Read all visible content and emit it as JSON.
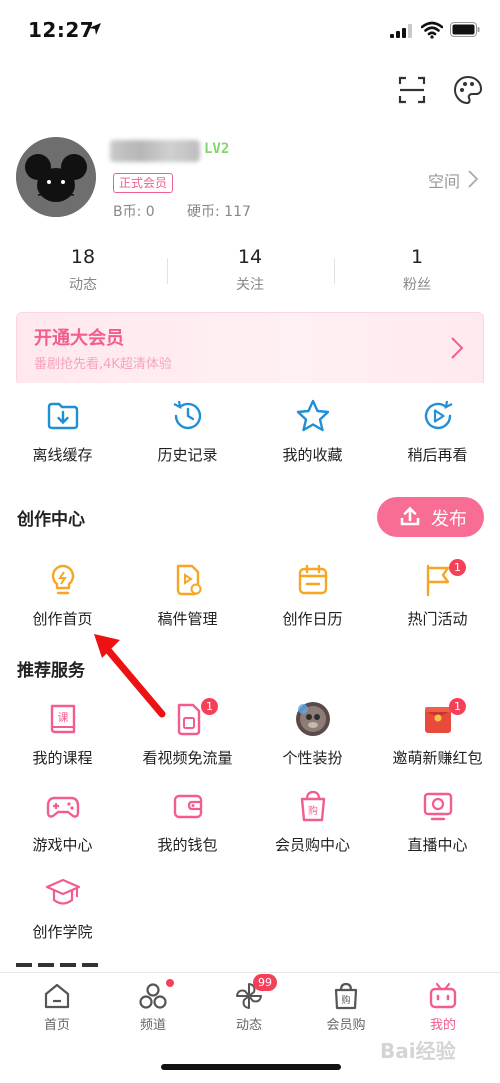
{
  "status_bar": {
    "time": "12:27"
  },
  "profile": {
    "level": "LV2",
    "member_badge": "正式会员",
    "b_coin": "B币: 0",
    "hard_coin": "硬币: 117",
    "space_link": "空间"
  },
  "stats": [
    {
      "value": "18",
      "label": "动态"
    },
    {
      "value": "14",
      "label": "关注"
    },
    {
      "value": "1",
      "label": "粉丝"
    }
  ],
  "vip": {
    "title": "开通大会员",
    "subtitle": "番剧抢先看,4K超清体验"
  },
  "quick_actions": [
    {
      "label": "离线缓存",
      "icon": "download-folder-icon"
    },
    {
      "label": "历史记录",
      "icon": "history-clock-icon"
    },
    {
      "label": "我的收藏",
      "icon": "star-icon"
    },
    {
      "label": "稍后再看",
      "icon": "watch-later-icon"
    }
  ],
  "creation": {
    "title": "创作中心",
    "publish_label": "发布",
    "items": [
      {
        "label": "创作首页",
        "icon": "lightbulb-icon"
      },
      {
        "label": "稿件管理",
        "icon": "manuscript-icon"
      },
      {
        "label": "创作日历",
        "icon": "calendar-icon"
      },
      {
        "label": "热门活动",
        "icon": "flag-icon",
        "badge": "1"
      }
    ]
  },
  "services": {
    "title": "推荐服务",
    "items": [
      {
        "label": "我的课程",
        "icon": "course-book-icon"
      },
      {
        "label": "看视频免流量",
        "icon": "sim-card-icon",
        "badge": "1"
      },
      {
        "label": "个性装扮",
        "icon": "avatar-decoration-icon"
      },
      {
        "label": "邀萌新赚红包",
        "icon": "red-envelope-icon",
        "badge": "1"
      },
      {
        "label": "游戏中心",
        "icon": "gamepad-icon"
      },
      {
        "label": "我的钱包",
        "icon": "wallet-icon"
      },
      {
        "label": "会员购中心",
        "icon": "shopping-bag-icon"
      },
      {
        "label": "直播中心",
        "icon": "live-tv-icon"
      },
      {
        "label": "创作学院",
        "icon": "graduation-cap-icon"
      }
    ]
  },
  "bottom_nav": [
    {
      "label": "首页",
      "icon": "home-icon"
    },
    {
      "label": "频道",
      "icon": "channel-icon"
    },
    {
      "label": "动态",
      "icon": "pinwheel-icon",
      "badge": "99"
    },
    {
      "label": "会员购",
      "icon": "shop-bag-icon"
    },
    {
      "label": "我的",
      "icon": "tv-mascot-icon",
      "active": true
    }
  ],
  "colors": {
    "accent": "#f25d8e",
    "icon_blue": "#1f8fd6",
    "icon_orange": "#f6a623",
    "badge_red": "#f5405a"
  },
  "watermark": "Bai经验"
}
